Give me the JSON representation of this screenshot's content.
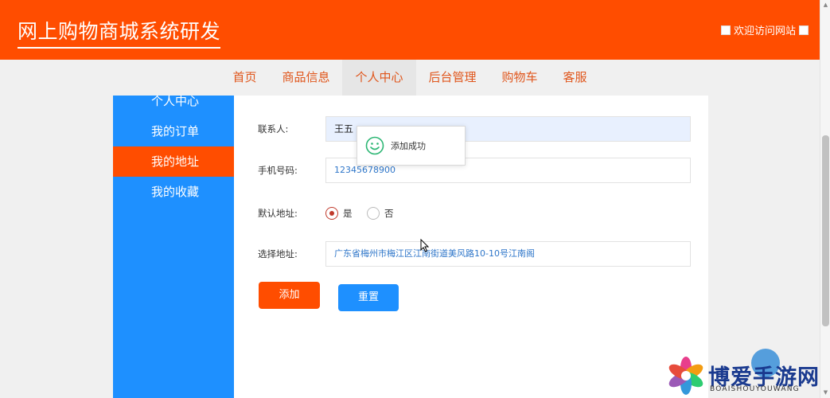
{
  "header": {
    "title": "网上购物商城系统研发",
    "visit_label": "欢迎访问网站"
  },
  "nav": {
    "items": [
      {
        "label": "首页",
        "active": false
      },
      {
        "label": "商品信息",
        "active": false
      },
      {
        "label": "个人中心",
        "active": true
      },
      {
        "label": "后台管理",
        "active": false
      },
      {
        "label": "购物车",
        "active": false
      },
      {
        "label": "客服",
        "active": false
      }
    ]
  },
  "sidebar": {
    "items": [
      {
        "label": "个人中心"
      },
      {
        "label": "我的订单"
      },
      {
        "label": "我的地址",
        "active": true
      },
      {
        "label": "我的收藏"
      }
    ]
  },
  "form": {
    "contact_label": "联系人:",
    "contact_value": "王五",
    "phone_label": "手机号码:",
    "phone_value": "12345678900",
    "default_label": "默认地址:",
    "default_yes": "是",
    "default_no": "否",
    "default_selected": "是",
    "address_label": "选择地址:",
    "address_value": "广东省梅州市梅江区江南街道美风路10-10号江南阁",
    "add_button": "添加",
    "reset_button": "重置"
  },
  "toast": {
    "message": "添加成功",
    "icon": "smiley-icon"
  },
  "watermark": {
    "text": "博爱手游网",
    "sub": "BOAISHOUYOUWANG"
  },
  "colors": {
    "brand": "#ff4d00",
    "accent": "#1e90ff",
    "radio": "#c0392b"
  }
}
